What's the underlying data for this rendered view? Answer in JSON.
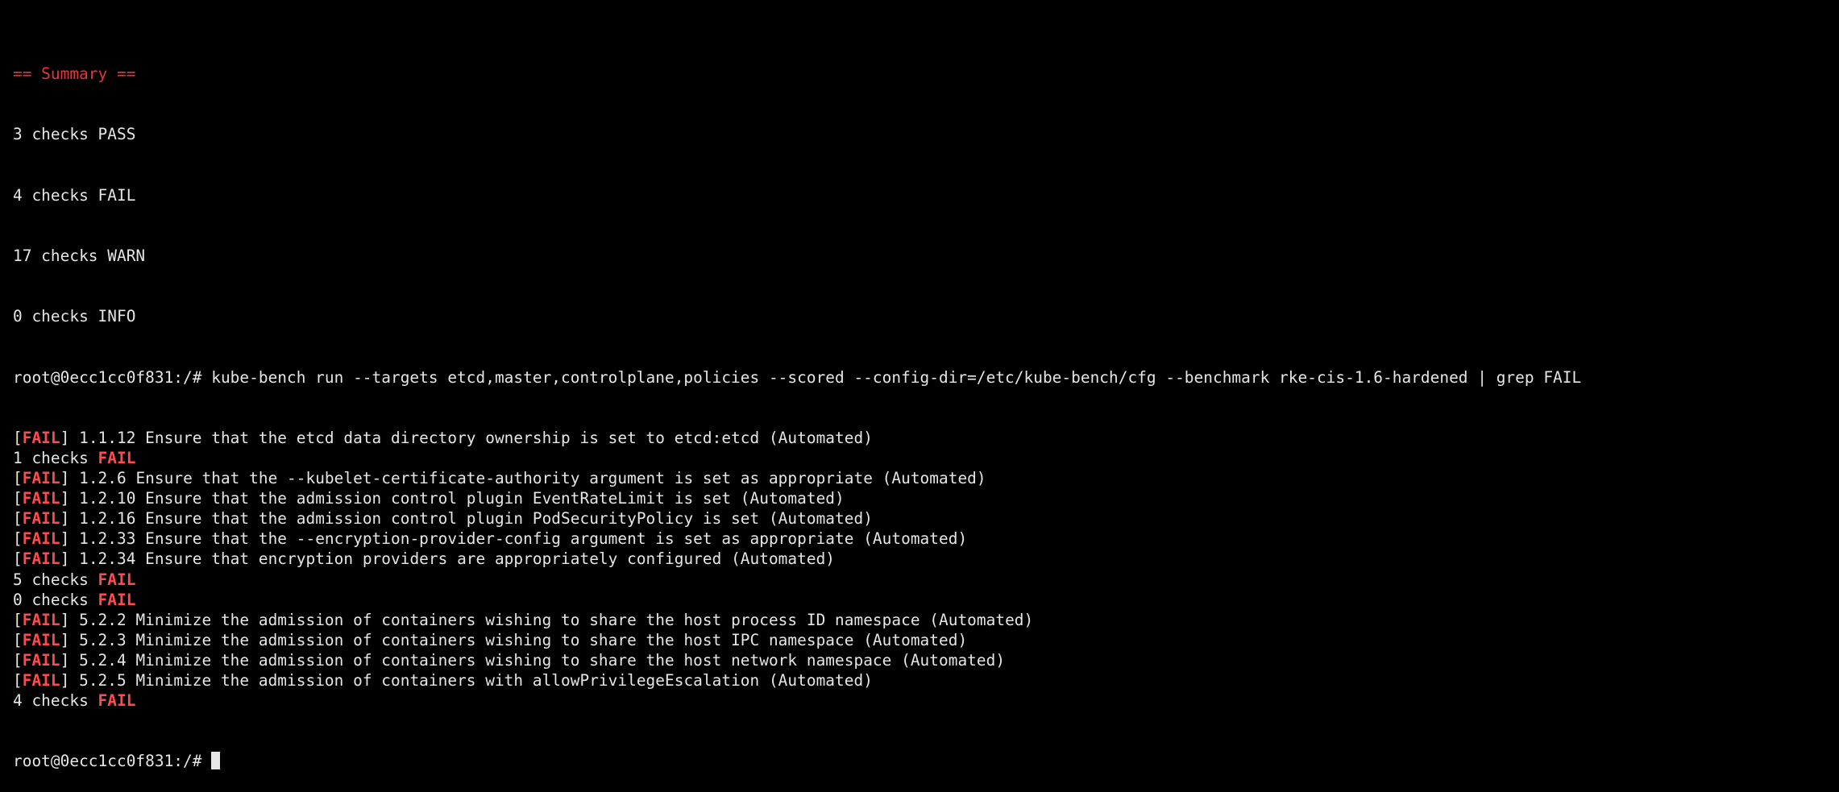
{
  "terminal": {
    "summary_header": "== Summary ==",
    "summary_lines": [
      "3 checks PASS",
      "4 checks FAIL",
      "17 checks WARN",
      "0 checks INFO"
    ],
    "prompt": "root@0ecc1cc0f831:/#",
    "command": "kube-bench run --targets etcd,master,controlplane,policies --scored --config-dir=/etc/kube-bench/cfg --benchmark rke-cis-1.6-hardened | grep FAIL",
    "fail_word": "FAIL",
    "output_lines": [
      {
        "type": "result",
        "text": " 1.1.12 Ensure that the etcd data directory ownership is set to etcd:etcd (Automated)"
      },
      {
        "type": "count",
        "text": "1 checks "
      },
      {
        "type": "result",
        "text": " 1.2.6 Ensure that the --kubelet-certificate-authority argument is set as appropriate (Automated)"
      },
      {
        "type": "result",
        "text": " 1.2.10 Ensure that the admission control plugin EventRateLimit is set (Automated)"
      },
      {
        "type": "result",
        "text": " 1.2.16 Ensure that the admission control plugin PodSecurityPolicy is set (Automated)"
      },
      {
        "type": "result",
        "text": " 1.2.33 Ensure that the --encryption-provider-config argument is set as appropriate (Automated)"
      },
      {
        "type": "result",
        "text": " 1.2.34 Ensure that encryption providers are appropriately configured (Automated)"
      },
      {
        "type": "count",
        "text": "5 checks "
      },
      {
        "type": "count",
        "text": "0 checks "
      },
      {
        "type": "result",
        "text": " 5.2.2 Minimize the admission of containers wishing to share the host process ID namespace (Automated)"
      },
      {
        "type": "result",
        "text": " 5.2.3 Minimize the admission of containers wishing to share the host IPC namespace (Automated)"
      },
      {
        "type": "result",
        "text": " 5.2.4 Minimize the admission of containers wishing to share the host network namespace (Automated)"
      },
      {
        "type": "result",
        "text": " 5.2.5 Minimize the admission of containers with allowPrivilegeEscalation (Automated)"
      },
      {
        "type": "count",
        "text": "4 checks "
      }
    ]
  },
  "colors": {
    "background": "#000000",
    "foreground": "#e6e6e6",
    "summary_red": "#e0383b",
    "fail_red": "#ff4a4e"
  }
}
